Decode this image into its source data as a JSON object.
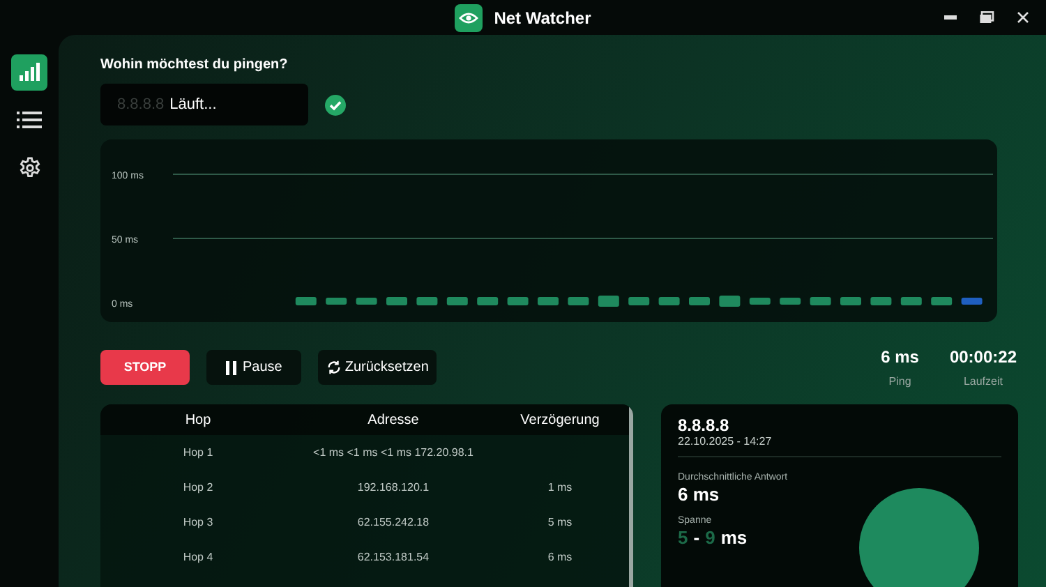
{
  "window": {
    "title": "Net Watcher"
  },
  "sidebar": {
    "items": [
      {
        "kind": "chart",
        "selected": true
      },
      {
        "kind": "list",
        "selected": false
      },
      {
        "kind": "settings",
        "selected": false
      }
    ]
  },
  "target": {
    "label": "Wohin möchtest du pingen?",
    "value": "8.8.8.8",
    "disabled": true,
    "status": "Läuft...",
    "valid": true
  },
  "chart": {
    "axis_labels": [
      "100 ms",
      "50 ms",
      "0 ms"
    ]
  },
  "controls": [
    {
      "kind": "stop",
      "label": "STOPP"
    },
    {
      "kind": "pause",
      "label": "Pause"
    },
    {
      "kind": "reset",
      "label": "Zurücksetzen"
    }
  ],
  "stats": [
    {
      "value": "6 ms",
      "label": "Ping"
    },
    {
      "value": "00:00:22",
      "label": "Laufzeit"
    }
  ],
  "table": {
    "columns": [
      "Hop",
      "Adresse",
      "Verzögerung"
    ],
    "rows": [
      [
        "Hop 1",
        "<1 ms <1 ms <1 ms 172.20.98.1",
        ""
      ],
      [
        "Hop 2",
        "192.168.120.1",
        "1 ms"
      ],
      [
        "Hop 3",
        "62.155.242.18",
        "5 ms"
      ],
      [
        "Hop 4",
        "62.153.181.54",
        "6 ms"
      ]
    ]
  },
  "summary": {
    "host": "8.8.8.8",
    "timestamp": "22.10.2025 - 14:27",
    "average_label": "Durchschnittliche Antwort",
    "average": "6 ms",
    "range_label": "Spanne",
    "range_min": "5",
    "range_sep": "-",
    "range_max": "9",
    "range_unit": "ms"
  }
}
